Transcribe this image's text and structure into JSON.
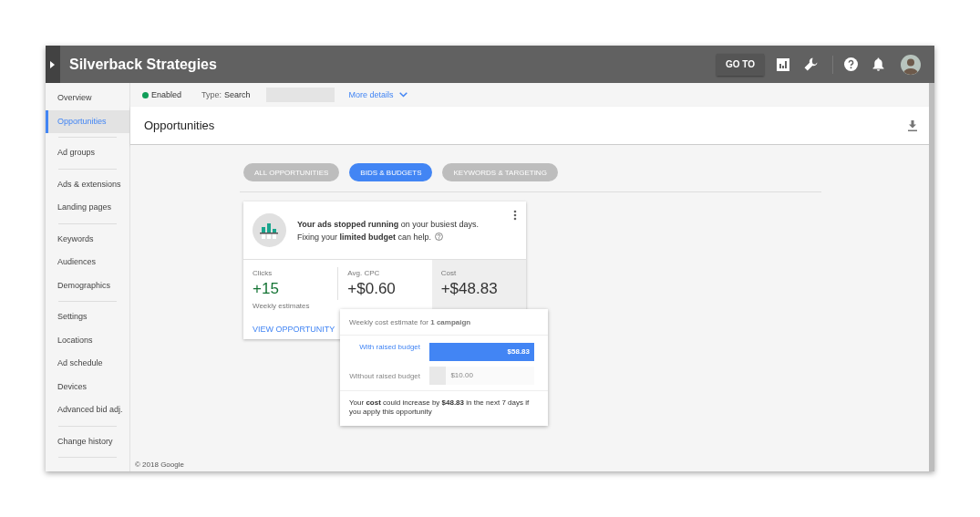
{
  "header": {
    "title": "Silverback Strategies",
    "goto_button": "GO TO"
  },
  "sidebar": {
    "groups": [
      {
        "items": [
          {
            "label": "Overview",
            "selected": false
          },
          {
            "label": "Opportunities",
            "selected": true
          }
        ]
      },
      {
        "items": [
          {
            "label": "Ad groups",
            "selected": false
          }
        ]
      },
      {
        "items": [
          {
            "label": "Ads & extensions",
            "selected": false
          },
          {
            "label": "Landing pages",
            "selected": false
          }
        ]
      },
      {
        "items": [
          {
            "label": "Keywords",
            "selected": false
          },
          {
            "label": "Audiences",
            "selected": false
          },
          {
            "label": "Demographics",
            "selected": false
          }
        ]
      },
      {
        "items": [
          {
            "label": "Settings",
            "selected": false
          },
          {
            "label": "Locations",
            "selected": false
          },
          {
            "label": "Ad schedule",
            "selected": false
          },
          {
            "label": "Devices",
            "selected": false
          },
          {
            "label": "Advanced bid adj.",
            "selected": false
          }
        ]
      },
      {
        "items": [
          {
            "label": "Change history",
            "selected": false
          }
        ]
      }
    ]
  },
  "status_bar": {
    "status": "Enabled",
    "enabled": true,
    "type_label": "Type:",
    "type_value": "Search",
    "more_details": "More details"
  },
  "page_title": "Opportunities",
  "filter_chips": [
    {
      "label": "ALL OPPORTUNITIES",
      "selected": false
    },
    {
      "label": "BIDS & BUDGETS",
      "selected": true
    },
    {
      "label": "KEYWORDS & TARGETING",
      "selected": false
    }
  ],
  "card": {
    "message": "**Your ads stopped running** on your busiest days.",
    "message_2": "Fixing your **limited budget** can help.",
    "metrics": [
      {
        "label": "Clicks",
        "value": "+15",
        "color": "#137333",
        "highlighted": false
      },
      {
        "label": "Avg. CPC",
        "value": "+$0.60",
        "color": "#333333",
        "highlighted": false
      },
      {
        "label": "Cost",
        "value": "+$48.83",
        "color": "#333333",
        "highlighted": true
      }
    ],
    "footnote": "Weekly estimates",
    "action": "VIEW OPPORTUNITY"
  },
  "tooltip": {
    "title": "Weekly cost estimate for **1 campaign**",
    "bars": [
      {
        "label": "With raised budget",
        "value": "$58.83",
        "level": 1,
        "highlighted": true
      },
      {
        "label": "Without raised budget",
        "value": "$10.00",
        "level": 0.16,
        "highlighted": false
      }
    ],
    "note": "Your **cost** could increase by **$48.83** in the next 7 days if you apply this opportunity"
  },
  "footer": "© 2018 Google"
}
